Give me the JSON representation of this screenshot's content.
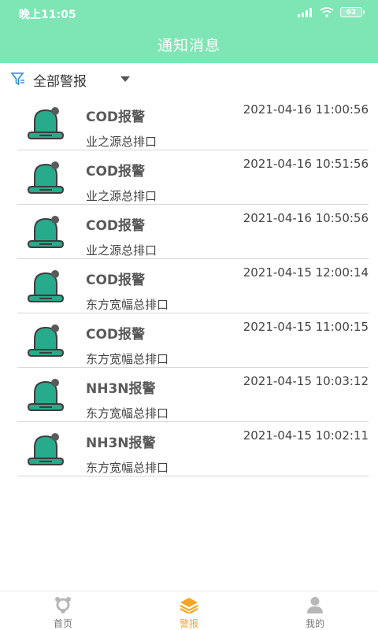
{
  "statusbar": {
    "time": "晚上11:05",
    "battery": "62"
  },
  "header": {
    "title": "通知消息"
  },
  "filter": {
    "label": "全部警报"
  },
  "colors": {
    "accent": "#7ee5b4",
    "bell": "#27ab8c",
    "active_tab": "#f6a623"
  },
  "alerts": [
    {
      "type": "COD报警",
      "time": "2021-04-16 11:00:56",
      "location": "业之源总排口"
    },
    {
      "type": "COD报警",
      "time": "2021-04-16 10:51:56",
      "location": "业之源总排口"
    },
    {
      "type": "COD报警",
      "time": "2021-04-16 10:50:56",
      "location": "业之源总排口"
    },
    {
      "type": "COD报警",
      "time": "2021-04-15 12:00:14",
      "location": "东方宽幅总排口"
    },
    {
      "type": "COD报警",
      "time": "2021-04-15 11:00:15",
      "location": "东方宽幅总排口"
    },
    {
      "type": "NH3N报警",
      "time": "2021-04-15 10:03:12",
      "location": "东方宽幅总排口"
    },
    {
      "type": "NH3N报警",
      "time": "2021-04-15 10:02:11",
      "location": "东方宽幅总排口"
    }
  ],
  "tabs": [
    {
      "label": "首页",
      "icon": "home-icon"
    },
    {
      "label": "警报",
      "icon": "layers-icon",
      "active": true
    },
    {
      "label": "我的",
      "icon": "user-icon"
    }
  ]
}
